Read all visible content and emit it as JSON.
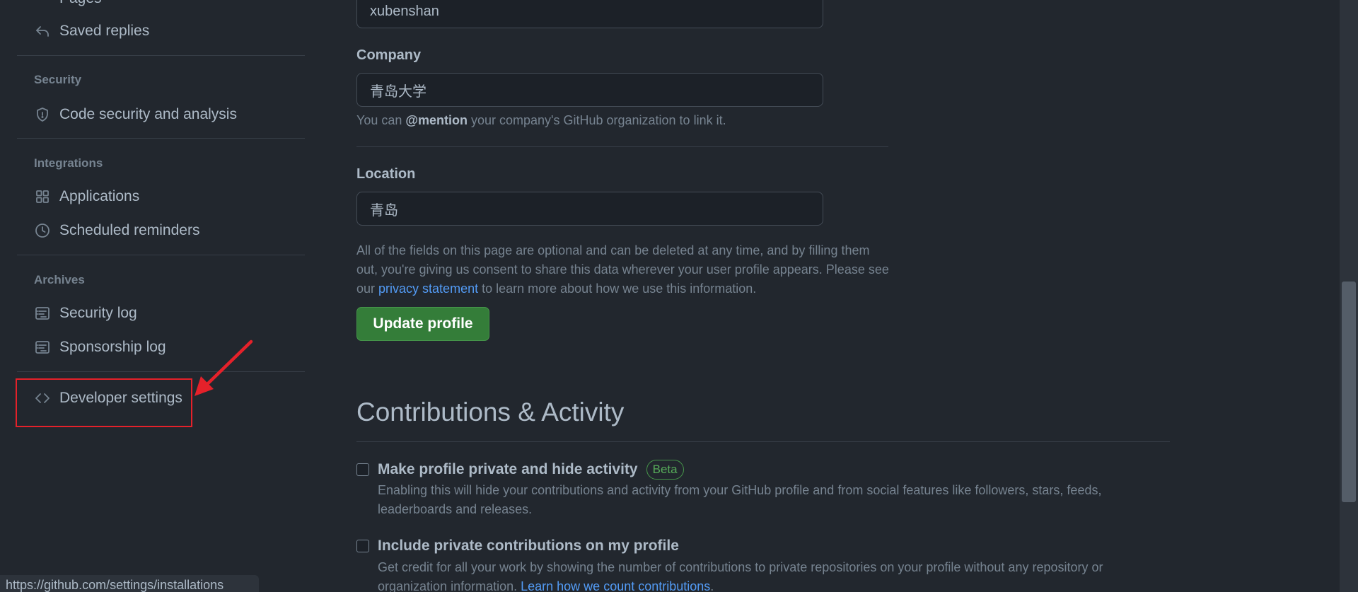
{
  "sidebar": {
    "partial_item": "Pages",
    "saved_replies": "Saved replies",
    "security_header": "Security",
    "code_security": "Code security and analysis",
    "integrations_header": "Integrations",
    "applications": "Applications",
    "scheduled_reminders": "Scheduled reminders",
    "archives_header": "Archives",
    "security_log": "Security log",
    "sponsorship_log": "Sponsorship log",
    "developer_settings": "Developer settings"
  },
  "status_bar": {
    "url": "https://github.com/settings/installations"
  },
  "profile": {
    "name_value": "xubenshan",
    "company_label": "Company",
    "company_value": "青岛大学",
    "company_help_pre": "You can ",
    "company_help_bold": "@mention",
    "company_help_post": " your company's GitHub organization to link it.",
    "location_label": "Location",
    "location_value": "青岛",
    "consent_pre": "All of the fields on this page are optional and can be deleted at any time, and by filling them out, you're giving us consent to share this data wherever your user profile appears. Please see our ",
    "consent_link": "privacy statement",
    "consent_post": " to learn more about how we use this information.",
    "update_button": "Update profile"
  },
  "contributions": {
    "title": "Contributions & Activity",
    "private_title": "Make profile private and hide activity",
    "private_badge": "Beta",
    "private_desc": "Enabling this will hide your contributions and activity from your GitHub profile and from social features like followers, stars, feeds, leaderboards and releases.",
    "include_title": "Include private contributions on my profile",
    "include_desc_pre": "Get credit for all your work by showing the number of contributions to private repositories on your profile without any repository or organization information. ",
    "include_link": "Learn how we count contributions",
    "include_desc_post": "."
  },
  "icons": {
    "saved_replies": "reply-icon",
    "code_security": "shield-icon",
    "applications": "apps-grid-icon",
    "scheduled_reminders": "clock-icon",
    "security_log": "log-icon",
    "sponsorship_log": "log-icon",
    "developer_settings": "code-icon"
  },
  "colors": {
    "background": "#22272e",
    "accent_green": "#347d39",
    "link_blue": "#539bf5",
    "annotation_red": "#e5212a"
  }
}
